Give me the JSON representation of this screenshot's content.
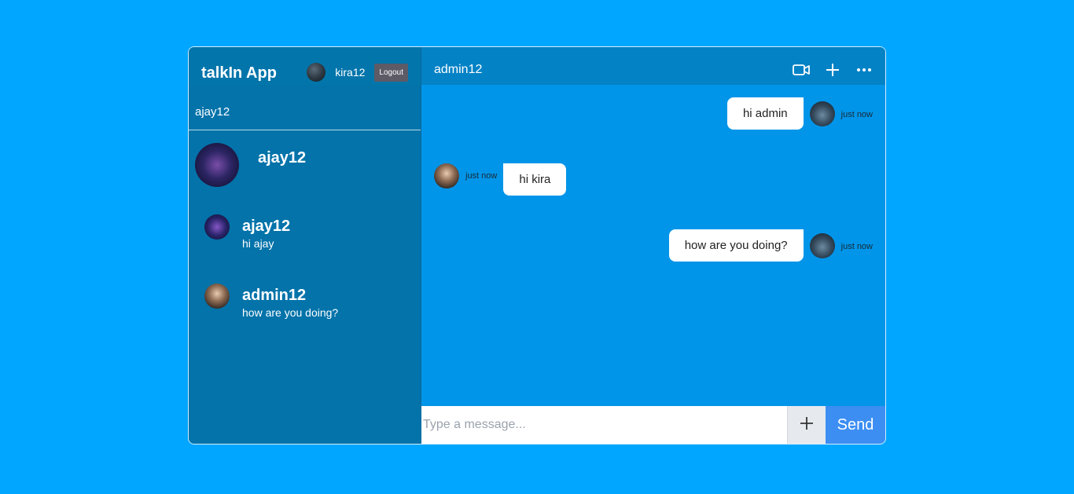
{
  "navbar": {
    "logo": "talkIn App",
    "username": "kira12",
    "logout_label": "Logout"
  },
  "search": {
    "value": "ajay12"
  },
  "found_user": {
    "name": "ajay12"
  },
  "chats": [
    {
      "name": "ajay12",
      "last_message": "hi ajay"
    },
    {
      "name": "admin12",
      "last_message": "how are you doing?"
    }
  ],
  "chat_header": {
    "title": "admin12",
    "icons": [
      "video-camera-icon",
      "plus-icon",
      "more-icon"
    ]
  },
  "messages": [
    {
      "text": "hi admin",
      "time": "just now",
      "owner": true
    },
    {
      "text": "hi kira",
      "time": "just now",
      "owner": false
    },
    {
      "text": "how are you doing?",
      "time": "just now",
      "owner": true
    }
  ],
  "input": {
    "placeholder": "Type a message...",
    "value": ""
  },
  "send_label": "Send",
  "colors": {
    "background": "#00a6ff",
    "sidebar": "#0373aa",
    "chat_background": "#0095e9",
    "chat_header": "#0382c6",
    "send_button": "#3c8ef3"
  }
}
